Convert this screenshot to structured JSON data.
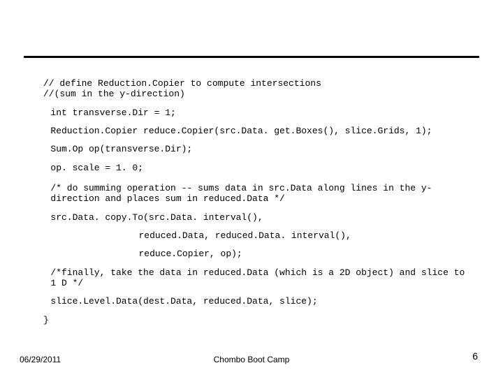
{
  "code": {
    "l1": "// define Reduction.Copier to compute intersections",
    "l2": "//(sum in the y-direction)",
    "l3": "int transverse.Dir = 1;",
    "l4": "Reduction.Copier reduce.Copier(src.Data. get.Boxes(), slice.Grids, 1);",
    "l5": "Sum.Op op(transverse.Dir);",
    "l6": "op. scale = 1. 0;",
    "l7": "/* do summing operation -- sums data in src.Data along lines in the y-direction and places sum in reduced.Data */",
    "l8": "src.Data. copy.To(src.Data. interval(),",
    "l9": "reduced.Data, reduced.Data. interval(),",
    "l10": "reduce.Copier, op);",
    "l11": "/*finally, take the data in reduced.Data (which is a 2D object) and slice to 1 D */",
    "l12": "slice.Level.Data(dest.Data, reduced.Data, slice);",
    "l13": "}"
  },
  "footer": {
    "date": "06/29/2011",
    "title": "Chombo Boot Camp",
    "page": "6"
  }
}
